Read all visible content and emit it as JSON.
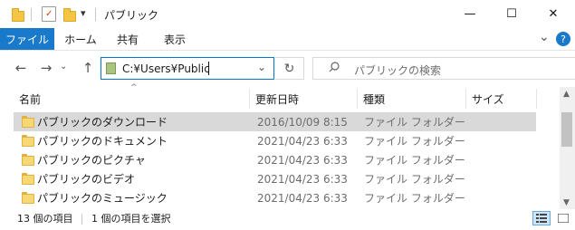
{
  "window": {
    "title": "パブリック",
    "minimize_glyph": "—",
    "maximize_glyph": "☐",
    "close_glyph": "✕"
  },
  "ribbon": {
    "tabs": [
      "ファイル",
      "ホーム",
      "共有",
      "表示"
    ],
    "expand_glyph": "⌄",
    "help_glyph": "?"
  },
  "address": {
    "path": "C:¥Users¥Public",
    "search_placeholder": "パブリックの検索"
  },
  "columns": [
    "名前",
    "更新日時",
    "種類",
    "サイズ"
  ],
  "rows": [
    {
      "name": "パブリックのダウンロード",
      "date": "2016/10/09 8:15",
      "type": "ファイル フォルダー",
      "selected": true
    },
    {
      "name": "パブリックのドキュメント",
      "date": "2021/04/23 6:33",
      "type": "ファイル フォルダー",
      "selected": false
    },
    {
      "name": "パブリックのピクチャ",
      "date": "2021/04/23 6:33",
      "type": "ファイル フォルダー",
      "selected": false
    },
    {
      "name": "パブリックのビデオ",
      "date": "2021/04/23 6:33",
      "type": "ファイル フォルダー",
      "selected": false
    },
    {
      "name": "パブリックのミュージック",
      "date": "2021/04/23 6:33",
      "type": "ファイル フォルダー",
      "selected": false
    }
  ],
  "status": {
    "item_count": "13 個の項目",
    "selection": "1 個の項目を選択"
  },
  "colors": {
    "accent": "#1979ca",
    "selection": "#d9d9d9",
    "folder": "#f8d775"
  }
}
